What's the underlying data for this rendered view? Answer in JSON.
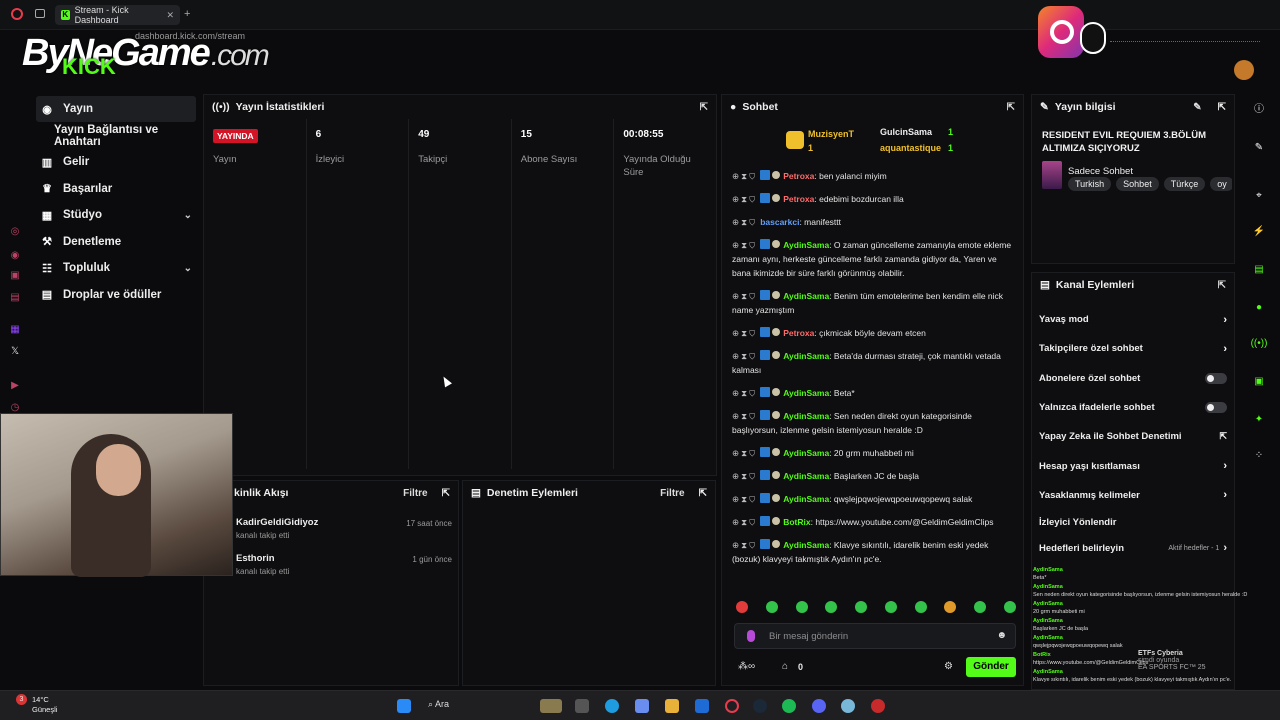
{
  "browser": {
    "tab_title": "Stream - Kick Dashboard",
    "url": "dashboard.kick.com/stream",
    "new_tab": "+"
  },
  "overlay": {
    "logo_main": "ByNeGame",
    "logo_sub": ".com",
    "logo_kick": "KICK"
  },
  "sidebar": {
    "items": [
      {
        "label": "Yayın",
        "icon": "broadcast-icon"
      },
      {
        "label": "Yayın Bağlantısı ve Anahtarı",
        "icon": ""
      },
      {
        "label": "Gelir",
        "icon": "chart-icon"
      },
      {
        "label": "Başarılar",
        "icon": "trophy-icon"
      },
      {
        "label": "Stüdyo",
        "icon": "grid-icon"
      },
      {
        "label": "Denetleme",
        "icon": "hammer-icon"
      },
      {
        "label": "Topluluk",
        "icon": "people-icon"
      },
      {
        "label": "Droplar ve ödüller",
        "icon": "gift-icon"
      }
    ]
  },
  "stats": {
    "title": "Yayın İstatistikleri",
    "live_badge": "YAYINDA",
    "cols": [
      {
        "value": "",
        "label": "Yayın"
      },
      {
        "value": "6",
        "label": "İzleyici"
      },
      {
        "value": "49",
        "label": "Takipçi"
      },
      {
        "value": "15",
        "label": "Abone Sayısı"
      },
      {
        "value": "00:08:55",
        "label": "Yayında Olduğu Süre"
      }
    ]
  },
  "activity": {
    "title": "kinlik Akışı",
    "filter": "Filtre",
    "rows": [
      {
        "name": "KadirGeldiGidiyoz",
        "sub": "kanalı takip etti",
        "time": "17 saat önce"
      },
      {
        "name": "Esthorin",
        "sub": "kanalı takip etti",
        "time": "1 gün önce"
      }
    ]
  },
  "moderation": {
    "title": "Denetim Eylemleri",
    "filter": "Filtre"
  },
  "chat": {
    "title": "Sohbet",
    "top_gifters": [
      {
        "name": "MuzisyenT",
        "count": "1"
      },
      {
        "name": "GulcinSama",
        "count": "1"
      },
      {
        "name": "aquantastique",
        "count": "1"
      }
    ],
    "messages": [
      {
        "user": "Petroxa",
        "color": "#ff6b6b",
        "text": ": ben yalanci miyim"
      },
      {
        "user": "Petroxa",
        "color": "#ff6b6b",
        "text": ": edebimi bozdurcan illa"
      },
      {
        "user": "bascarkci",
        "color": "#5ea0ff",
        "text": ": manifesttt"
      },
      {
        "user": "AydinSama",
        "color": "#53fc18",
        "text": ": O zaman güncelleme zamanıyla emote ekleme zamanı aynı, herkeste güncelleme farklı zamanda gidiyor da, Yaren ve bana ikimizde bir süre farklı görünmüş olabilir."
      },
      {
        "user": "AydinSama",
        "color": "#53fc18",
        "text": ": Benim tüm emotelerime ben kendim elle nick name yazmıştım"
      },
      {
        "user": "Petroxa",
        "color": "#ff6b6b",
        "text": ": çıkmicak böyle devam etcen"
      },
      {
        "user": "AydinSama",
        "color": "#53fc18",
        "text": ": Beta'da durması strateji, çok mantıklı vetada kalması"
      },
      {
        "user": "AydinSama",
        "color": "#53fc18",
        "text": ": Beta*"
      },
      {
        "user": "AydinSama",
        "color": "#53fc18",
        "text": ": Sen neden direkt oyun kategorisinde başlıyorsun, izlenme gelsin istemiyosun heralde :D"
      },
      {
        "user": "AydinSama",
        "color": "#53fc18",
        "text": ": 20 grm muhabbeti mi"
      },
      {
        "user": "AydinSama",
        "color": "#53fc18",
        "text": ": Başlarken JC de başla"
      },
      {
        "user": "AydinSama",
        "color": "#53fc18",
        "text": ": qwşlejpqwojewqpoeuwqopewq salak"
      },
      {
        "user": "BotRix",
        "color": "#53fc18",
        "text": ": https://www.youtube.com/@GeldimGeldimClips"
      },
      {
        "user": "AydinSama",
        "color": "#53fc18",
        "text": ": Klavye sıkıntılı, idarelik benim eski yedek (bozuk) klavyeyi takmıştık Aydın'ın pc'e."
      }
    ],
    "input_placeholder": "Bir mesaj gönderin",
    "send_label": "Gönder",
    "viewer_count": "0"
  },
  "info": {
    "title": "Yayın bilgisi",
    "stream_title": "RESIDENT EVIL REQUIEM 3.BÖLÜM ALTIMIZA SIÇIYORUZ",
    "category": "Sadece Sohbet",
    "tags": [
      "Turkish",
      "Sohbet",
      "Türkçe",
      "oy"
    ]
  },
  "channel_actions": {
    "title": "Kanal Eylemleri",
    "items": [
      {
        "label": "Yavaş mod",
        "control": "chevron"
      },
      {
        "label": "Takipçilere özel sohbet",
        "control": "chevron"
      },
      {
        "label": "Abonelere özel sohbet",
        "control": "toggle"
      },
      {
        "label": "Yalnızca ifadelerle sohbet",
        "control": "toggle"
      },
      {
        "label": "Yapay Zeka ile Sohbet Denetimi",
        "control": "external"
      },
      {
        "label": "Hesap yaşı kısıtlaması",
        "control": "chevron"
      },
      {
        "label": "Yasaklanmış kelimeler",
        "control": "chevron"
      },
      {
        "label": "İzleyici Yönlendir",
        "control": "none"
      },
      {
        "label": "Hedefleri belirleyin",
        "control": "chevron"
      }
    ],
    "goals_status": "Aktif hedefler - 1"
  },
  "overlay_chat": {
    "lines": [
      {
        "user": "AydinSama",
        "text": "Beta*"
      },
      {
        "user": "AydinSama",
        "text": "Sen neden direkt oyun kategorisinde başlıyorsun, izlenme gelsin istemiyosun heralde :D"
      },
      {
        "user": "AydinSama",
        "text": "20 grm muhabbeti mi"
      },
      {
        "user": "AydinSama",
        "text": "Başlarken JC de başla"
      },
      {
        "user": "AydinSama",
        "text": "qwşlejpqwojewqpoeuwqopewq salak"
      },
      {
        "user": "BotRix",
        "text": "https://www.youtube.com/@GeldimGeldimClips"
      },
      {
        "user": "AydinSama",
        "text": "Klavye sıkıntılı, idarelik benim eski yedek (bozuk) klavyeyi takmıştık Aydın'ın pc'e."
      }
    ],
    "now_playing_user": "ETFs Cyberia",
    "now_playing_sub": "şimdi oyunda",
    "now_playing_game": "EA SPORTS FC™ 25"
  },
  "taskbar": {
    "weather_temp": "14°C",
    "weather_desc": "Güneşli",
    "search": "Ara",
    "notif_count": "3"
  },
  "colors": {
    "kick_green": "#53fc18",
    "live_red": "#d31426",
    "bg": "#0b0b0d"
  }
}
